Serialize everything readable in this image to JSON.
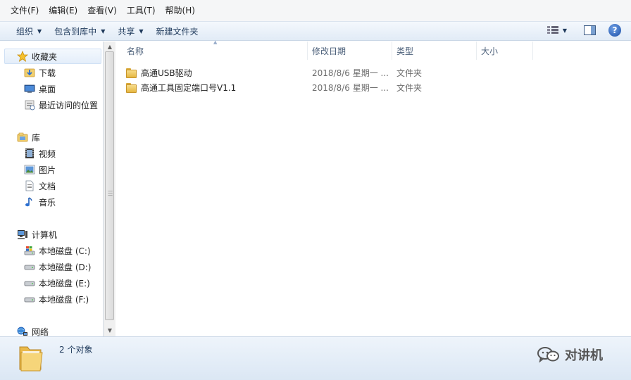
{
  "menubar": {
    "items": [
      {
        "label": "文件(F)"
      },
      {
        "label": "编辑(E)"
      },
      {
        "label": "查看(V)"
      },
      {
        "label": "工具(T)"
      },
      {
        "label": "帮助(H)"
      }
    ]
  },
  "toolbar": {
    "organize": "组织",
    "include_library": "包含到库中",
    "share": "共享",
    "new_folder": "新建文件夹"
  },
  "nav": {
    "favorites": "收藏夹",
    "downloads": "下载",
    "desktop": "桌面",
    "recent": "最近访问的位置",
    "libraries": "库",
    "videos": "视频",
    "pictures": "图片",
    "documents": "文档",
    "music": "音乐",
    "computer": "计算机",
    "drive_c": "本地磁盘 (C:)",
    "drive_d": "本地磁盘 (D:)",
    "drive_e": "本地磁盘 (E:)",
    "drive_f": "本地磁盘 (F:)",
    "network": "网络"
  },
  "columns": {
    "name": "名称",
    "modified": "修改日期",
    "type": "类型",
    "size": "大小"
  },
  "files": [
    {
      "name": "高通USB驱动",
      "modified": "2018/8/6 星期一 ...",
      "type": "文件夹"
    },
    {
      "name": "高通工具固定端口号V1.1",
      "modified": "2018/8/6 星期一 ...",
      "type": "文件夹"
    }
  ],
  "status": {
    "count": "2 个对象"
  },
  "watermark": {
    "text": "对讲机"
  }
}
